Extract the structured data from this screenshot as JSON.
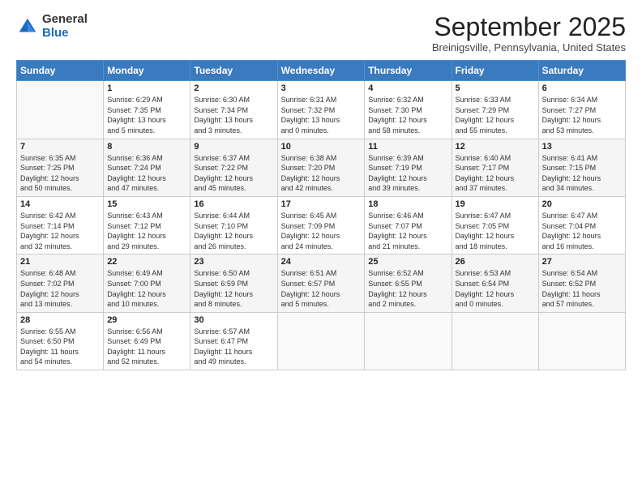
{
  "logo": {
    "general": "General",
    "blue": "Blue"
  },
  "header": {
    "month_year": "September 2025",
    "location": "Breinigsville, Pennsylvania, United States"
  },
  "weekdays": [
    "Sunday",
    "Monday",
    "Tuesday",
    "Wednesday",
    "Thursday",
    "Friday",
    "Saturday"
  ],
  "weeks": [
    [
      {
        "day": "",
        "info": ""
      },
      {
        "day": "1",
        "info": "Sunrise: 6:29 AM\nSunset: 7:35 PM\nDaylight: 13 hours\nand 5 minutes."
      },
      {
        "day": "2",
        "info": "Sunrise: 6:30 AM\nSunset: 7:34 PM\nDaylight: 13 hours\nand 3 minutes."
      },
      {
        "day": "3",
        "info": "Sunrise: 6:31 AM\nSunset: 7:32 PM\nDaylight: 13 hours\nand 0 minutes."
      },
      {
        "day": "4",
        "info": "Sunrise: 6:32 AM\nSunset: 7:30 PM\nDaylight: 12 hours\nand 58 minutes."
      },
      {
        "day": "5",
        "info": "Sunrise: 6:33 AM\nSunset: 7:29 PM\nDaylight: 12 hours\nand 55 minutes."
      },
      {
        "day": "6",
        "info": "Sunrise: 6:34 AM\nSunset: 7:27 PM\nDaylight: 12 hours\nand 53 minutes."
      }
    ],
    [
      {
        "day": "7",
        "info": "Sunrise: 6:35 AM\nSunset: 7:25 PM\nDaylight: 12 hours\nand 50 minutes."
      },
      {
        "day": "8",
        "info": "Sunrise: 6:36 AM\nSunset: 7:24 PM\nDaylight: 12 hours\nand 47 minutes."
      },
      {
        "day": "9",
        "info": "Sunrise: 6:37 AM\nSunset: 7:22 PM\nDaylight: 12 hours\nand 45 minutes."
      },
      {
        "day": "10",
        "info": "Sunrise: 6:38 AM\nSunset: 7:20 PM\nDaylight: 12 hours\nand 42 minutes."
      },
      {
        "day": "11",
        "info": "Sunrise: 6:39 AM\nSunset: 7:19 PM\nDaylight: 12 hours\nand 39 minutes."
      },
      {
        "day": "12",
        "info": "Sunrise: 6:40 AM\nSunset: 7:17 PM\nDaylight: 12 hours\nand 37 minutes."
      },
      {
        "day": "13",
        "info": "Sunrise: 6:41 AM\nSunset: 7:15 PM\nDaylight: 12 hours\nand 34 minutes."
      }
    ],
    [
      {
        "day": "14",
        "info": "Sunrise: 6:42 AM\nSunset: 7:14 PM\nDaylight: 12 hours\nand 32 minutes."
      },
      {
        "day": "15",
        "info": "Sunrise: 6:43 AM\nSunset: 7:12 PM\nDaylight: 12 hours\nand 29 minutes."
      },
      {
        "day": "16",
        "info": "Sunrise: 6:44 AM\nSunset: 7:10 PM\nDaylight: 12 hours\nand 26 minutes."
      },
      {
        "day": "17",
        "info": "Sunrise: 6:45 AM\nSunset: 7:09 PM\nDaylight: 12 hours\nand 24 minutes."
      },
      {
        "day": "18",
        "info": "Sunrise: 6:46 AM\nSunset: 7:07 PM\nDaylight: 12 hours\nand 21 minutes."
      },
      {
        "day": "19",
        "info": "Sunrise: 6:47 AM\nSunset: 7:05 PM\nDaylight: 12 hours\nand 18 minutes."
      },
      {
        "day": "20",
        "info": "Sunrise: 6:47 AM\nSunset: 7:04 PM\nDaylight: 12 hours\nand 16 minutes."
      }
    ],
    [
      {
        "day": "21",
        "info": "Sunrise: 6:48 AM\nSunset: 7:02 PM\nDaylight: 12 hours\nand 13 minutes."
      },
      {
        "day": "22",
        "info": "Sunrise: 6:49 AM\nSunset: 7:00 PM\nDaylight: 12 hours\nand 10 minutes."
      },
      {
        "day": "23",
        "info": "Sunrise: 6:50 AM\nSunset: 6:59 PM\nDaylight: 12 hours\nand 8 minutes."
      },
      {
        "day": "24",
        "info": "Sunrise: 6:51 AM\nSunset: 6:57 PM\nDaylight: 12 hours\nand 5 minutes."
      },
      {
        "day": "25",
        "info": "Sunrise: 6:52 AM\nSunset: 6:55 PM\nDaylight: 12 hours\nand 2 minutes."
      },
      {
        "day": "26",
        "info": "Sunrise: 6:53 AM\nSunset: 6:54 PM\nDaylight: 12 hours\nand 0 minutes."
      },
      {
        "day": "27",
        "info": "Sunrise: 6:54 AM\nSunset: 6:52 PM\nDaylight: 11 hours\nand 57 minutes."
      }
    ],
    [
      {
        "day": "28",
        "info": "Sunrise: 6:55 AM\nSunset: 6:50 PM\nDaylight: 11 hours\nand 54 minutes."
      },
      {
        "day": "29",
        "info": "Sunrise: 6:56 AM\nSunset: 6:49 PM\nDaylight: 11 hours\nand 52 minutes."
      },
      {
        "day": "30",
        "info": "Sunrise: 6:57 AM\nSunset: 6:47 PM\nDaylight: 11 hours\nand 49 minutes."
      },
      {
        "day": "",
        "info": ""
      },
      {
        "day": "",
        "info": ""
      },
      {
        "day": "",
        "info": ""
      },
      {
        "day": "",
        "info": ""
      }
    ]
  ]
}
